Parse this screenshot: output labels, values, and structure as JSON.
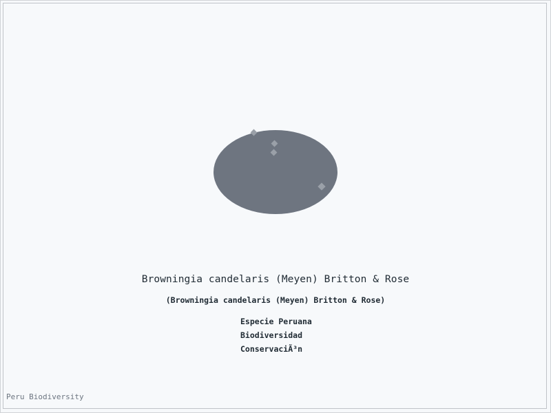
{
  "title": "Browningia candelaris (Meyen) Britton & Rose",
  "subtitle": "(Browningia candelaris (Meyen) Britton & Rose)",
  "tags": [
    "Especie Peruana",
    "Biodiversidad",
    "ConservaciÃ³n"
  ],
  "footer": "Peru Biodiversity",
  "colors": {
    "background": "#f7f9fb",
    "ellipse": "#6e7580",
    "dots": "#9aa0a8",
    "text": "#1f2a33",
    "footer": "#6c7580"
  }
}
